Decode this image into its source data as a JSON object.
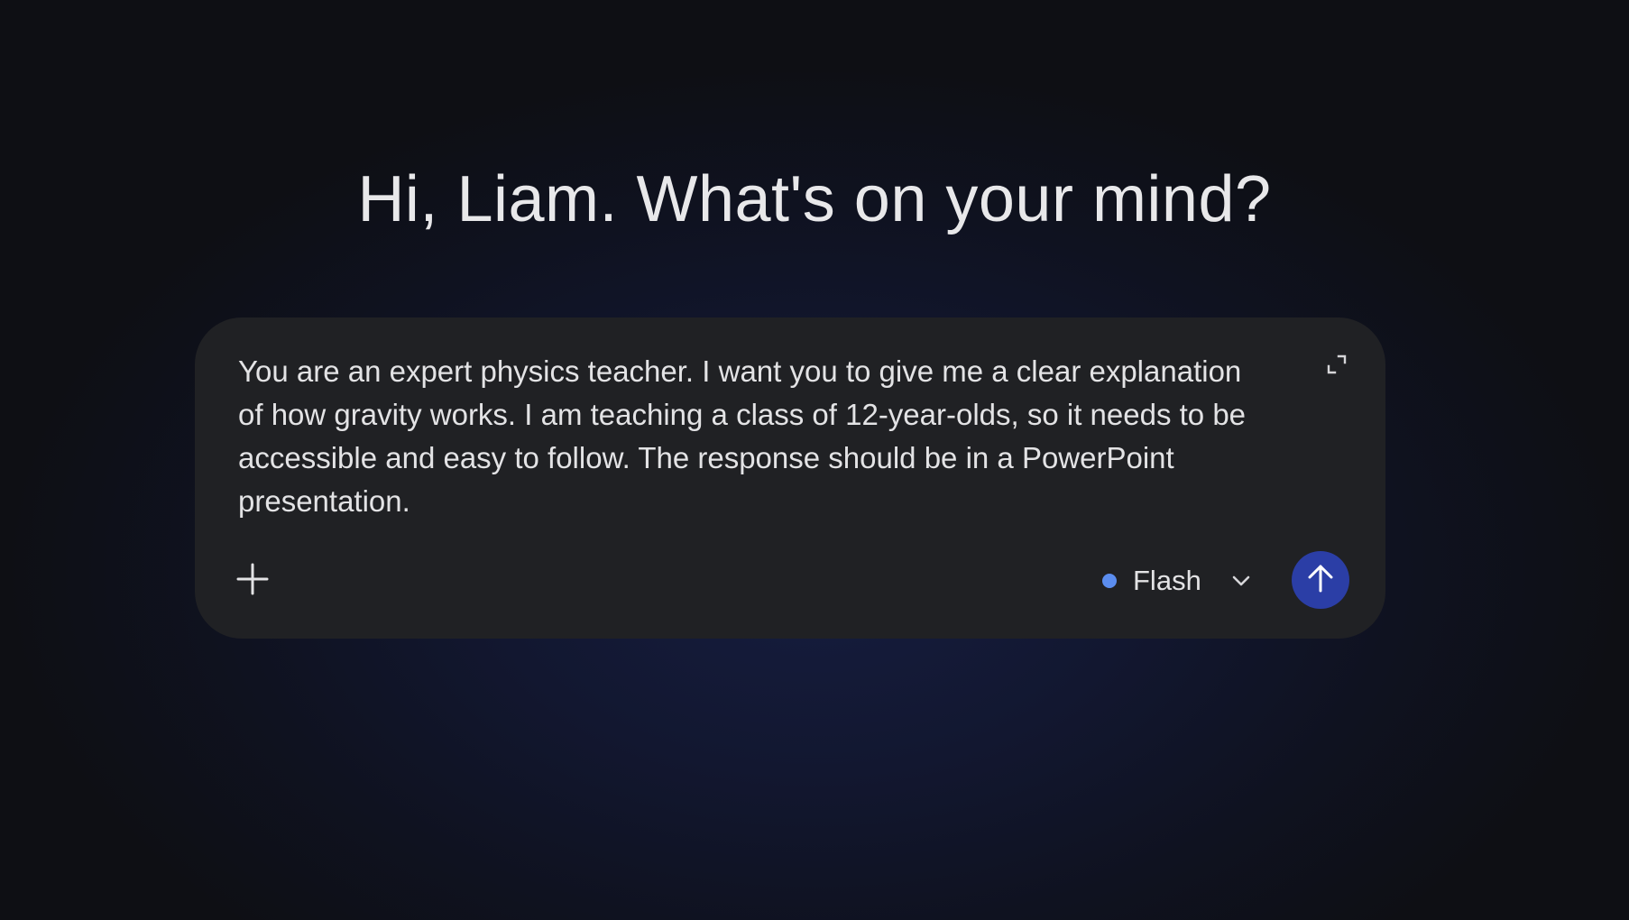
{
  "greeting": "Hi, Liam. What's on your mind?",
  "composer": {
    "prompt_text": "You are an expert physics teacher. I want you to give me a clear explanation of how gravity works. I am teaching a class of 12-year-olds, so it needs to be accessible and easy to follow. The response should be in a PowerPoint presentation.",
    "model_label": "Flash",
    "icons": {
      "expand": "expand-icon",
      "add": "plus-icon",
      "model_dot": "dot-indicator-icon",
      "chevron": "chevron-down-icon",
      "send": "arrow-up-icon"
    }
  },
  "colors": {
    "background": "#0e0f14",
    "background_glow": "#161d3f",
    "composer": "#202124",
    "model_dot": "#5b8def",
    "send_button": "#2b3ea6",
    "text": "#e3e3e5"
  }
}
